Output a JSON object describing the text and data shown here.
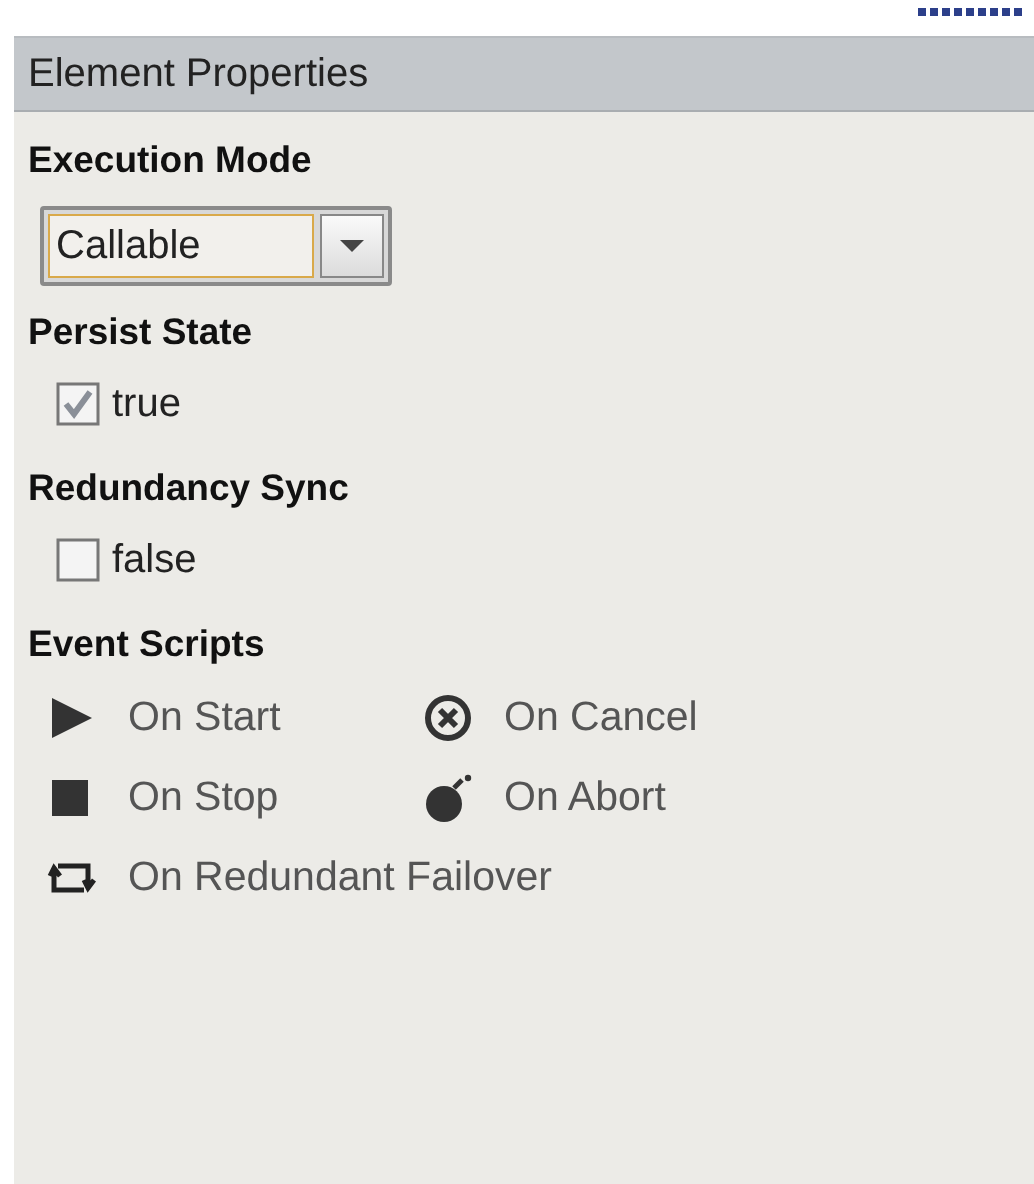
{
  "panel": {
    "title": "Element Properties"
  },
  "sections": [
    {
      "kind": "dropdown",
      "label": "Execution Mode",
      "value": "Callable"
    },
    {
      "kind": "checkbox",
      "label": "Persist State",
      "checked": true,
      "text": "true"
    },
    {
      "kind": "checkbox",
      "label": "Redundancy Sync",
      "checked": false,
      "text": "false"
    },
    {
      "kind": "scripts",
      "label": "Event Scripts",
      "items": [
        {
          "kind": "play",
          "text": "On Start"
        },
        {
          "kind": "cancel",
          "text": "On Cancel"
        },
        {
          "kind": "stop",
          "text": "On Stop"
        },
        {
          "kind": "bomb",
          "text": "On Abort"
        },
        {
          "kind": "loop",
          "text": "On Redundant Failover"
        }
      ]
    }
  ]
}
